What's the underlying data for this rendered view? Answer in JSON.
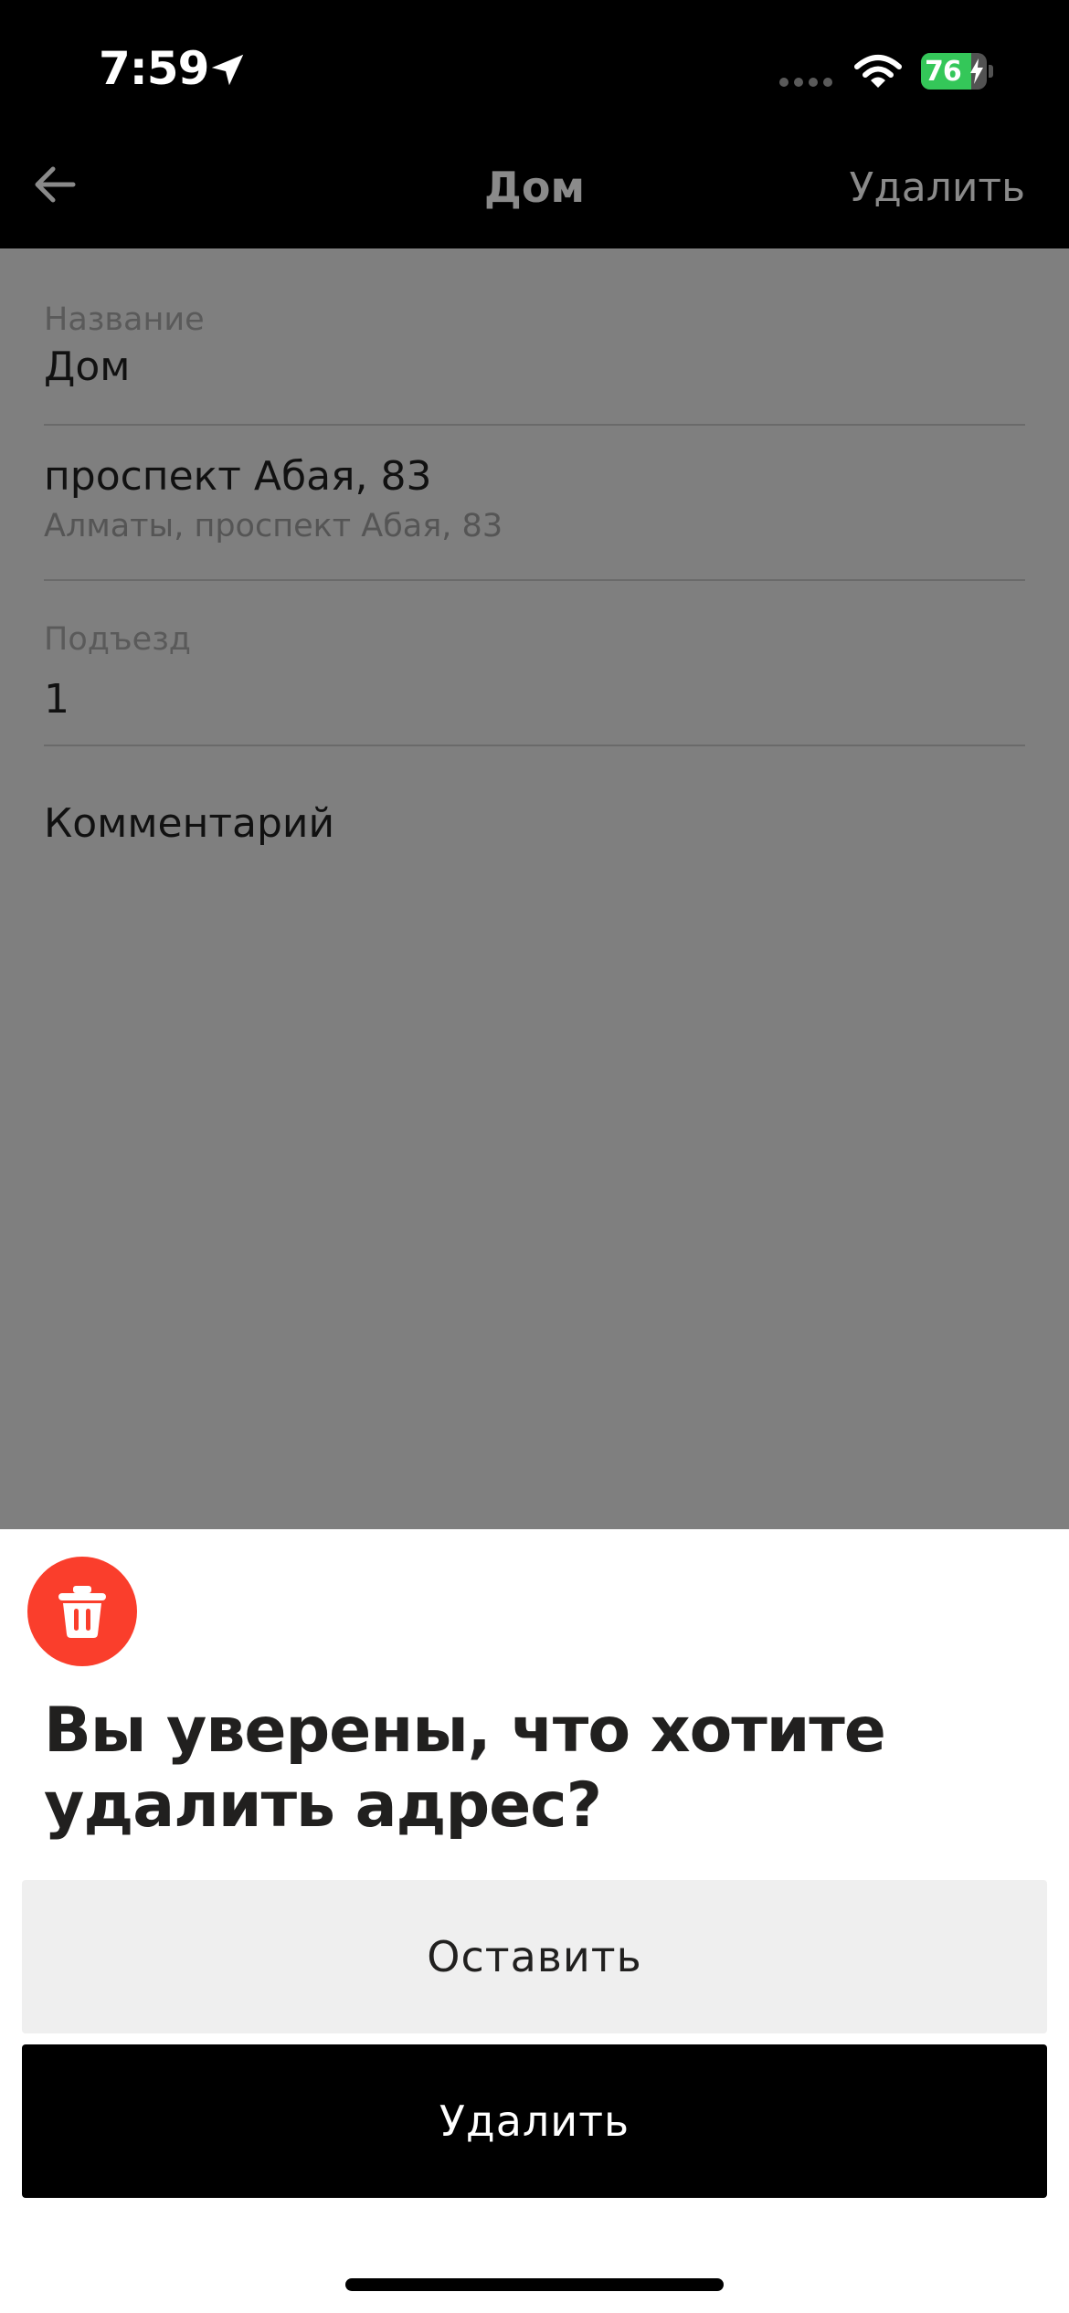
{
  "status_bar": {
    "time": "7:59",
    "battery_level": "76",
    "battery_fraction": 0.76,
    "battery_color": "#34c759",
    "icons": [
      "location-arrow-icon",
      "signal-icon",
      "wifi-icon",
      "battery-icon",
      "charging-bolt-icon"
    ]
  },
  "nav": {
    "back_icon": "arrow-left-icon",
    "title": "Дом",
    "delete_label": "Удалить"
  },
  "form": {
    "name_label": "Название",
    "name_value": "Дом",
    "address_main": "проспект Абая, 83",
    "address_sub": "Алматы, проспект Абая, 83",
    "entrance_label": "Подъезд",
    "entrance_value": "1",
    "comment_placeholder": "Комментарий"
  },
  "sheet": {
    "icon": "trash-icon",
    "icon_color": "#fa3e2c",
    "title": "Вы уверены, что хотите удалить адрес?",
    "keep_label": "Оставить",
    "delete_label": "Удалить"
  }
}
